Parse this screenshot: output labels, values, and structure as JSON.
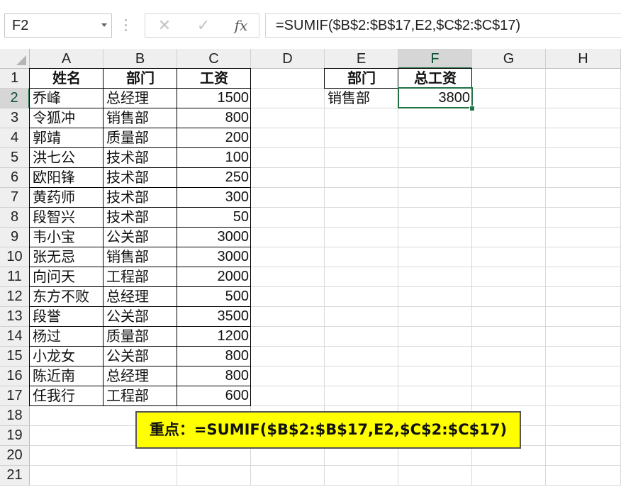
{
  "name_box": {
    "value": "F2"
  },
  "formula_bar": {
    "cancel_icon": "✕",
    "enter_icon": "✓",
    "fx_label": "fx",
    "formula": "=SUMIF($B$2:$B$17,E2,$C$2:$C$17)"
  },
  "columns": [
    "A",
    "B",
    "C",
    "D",
    "E",
    "F",
    "G",
    "H"
  ],
  "rows": [
    "1",
    "2",
    "3",
    "4",
    "5",
    "6",
    "7",
    "8",
    "9",
    "10",
    "11",
    "12",
    "13",
    "14",
    "15",
    "16",
    "17",
    "18",
    "19",
    "20",
    "21"
  ],
  "selected": {
    "column": "F",
    "row": "2"
  },
  "table": {
    "headers": [
      "姓名",
      "部门",
      "工资"
    ],
    "rows": [
      [
        "乔峰",
        "总经理",
        "1500"
      ],
      [
        "令狐冲",
        "销售部",
        "800"
      ],
      [
        "郭靖",
        "质量部",
        "200"
      ],
      [
        "洪七公",
        "技术部",
        "100"
      ],
      [
        "欧阳锋",
        "技术部",
        "250"
      ],
      [
        "黄药师",
        "技术部",
        "300"
      ],
      [
        "段智兴",
        "技术部",
        "50"
      ],
      [
        "韦小宝",
        "公关部",
        "3000"
      ],
      [
        "张无忌",
        "销售部",
        "3000"
      ],
      [
        "向问天",
        "工程部",
        "2000"
      ],
      [
        "东方不败",
        "总经理",
        "500"
      ],
      [
        "段誉",
        "公关部",
        "3500"
      ],
      [
        "杨过",
        "质量部",
        "1200"
      ],
      [
        "小龙女",
        "公关部",
        "800"
      ],
      [
        "陈近南",
        "总经理",
        "800"
      ],
      [
        "任我行",
        "工程部",
        "600"
      ]
    ]
  },
  "summary": {
    "headers": [
      "部门",
      "总工资"
    ],
    "criteria": "销售部",
    "result": "3800"
  },
  "callout": {
    "text": "重点：=SUMIF($B$2:$B$17,E2,$C$2:$C$17)"
  },
  "colors": {
    "accent": "#217346",
    "callout_bg": "#ffff00",
    "header_bg": "#efefef"
  }
}
